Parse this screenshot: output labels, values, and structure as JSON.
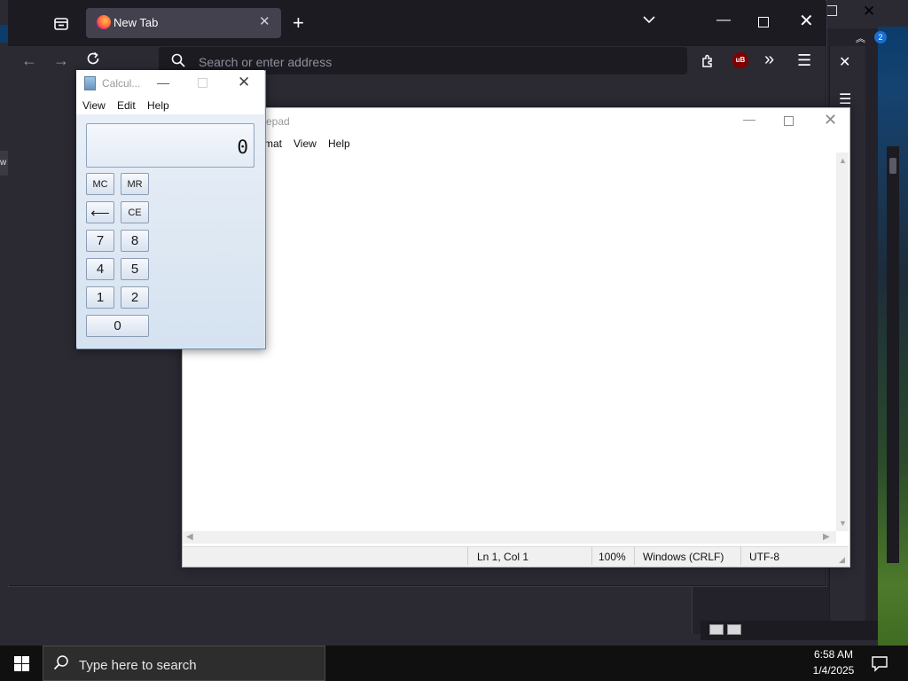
{
  "firefox": {
    "tab_title": "New Tab",
    "url_placeholder": "Search or enter address",
    "ublock_label": "uB"
  },
  "notepad": {
    "title": "otepad",
    "menus": [
      "mat",
      "View",
      "Help"
    ],
    "status": {
      "position": "Ln 1, Col 1",
      "zoom": "100%",
      "line_ending": "Windows (CRLF)",
      "encoding": "UTF-8"
    }
  },
  "calculator": {
    "title": "Calcul...",
    "menus": [
      "View",
      "Edit",
      "Help"
    ],
    "display": "0",
    "buttons": {
      "mc": "MC",
      "mr": "MR",
      "backspace": "⟵",
      "ce": "CE",
      "n7": "7",
      "n8": "8",
      "n4": "4",
      "n5": "5",
      "n1": "1",
      "n2": "2",
      "n0": "0"
    }
  },
  "background_window": {
    "left_edge_text": "w",
    "badge": "2"
  },
  "taskbar": {
    "search_placeholder": "Type here to search",
    "time": "6:58 AM",
    "date": "1/4/2025"
  },
  "colors": {
    "firefox_bg": "#1c1b22",
    "firefox_toolbar": "#2b2a33",
    "taskbar_bg": "#101010",
    "calc_body": "#dfe8f2"
  },
  "icons": [
    "tab-list-icon",
    "firefox-logo-icon",
    "close-icon",
    "plus-icon",
    "chevron-down-icon",
    "minimize-icon",
    "maximize-icon",
    "back-arrow-icon",
    "forward-arrow-icon",
    "reload-icon",
    "search-icon",
    "extensions-icon",
    "ublock-icon",
    "overflow-chevrons-icon",
    "hamburger-menu-icon",
    "calculator-icon",
    "windows-logo-icon",
    "notification-icon"
  ]
}
